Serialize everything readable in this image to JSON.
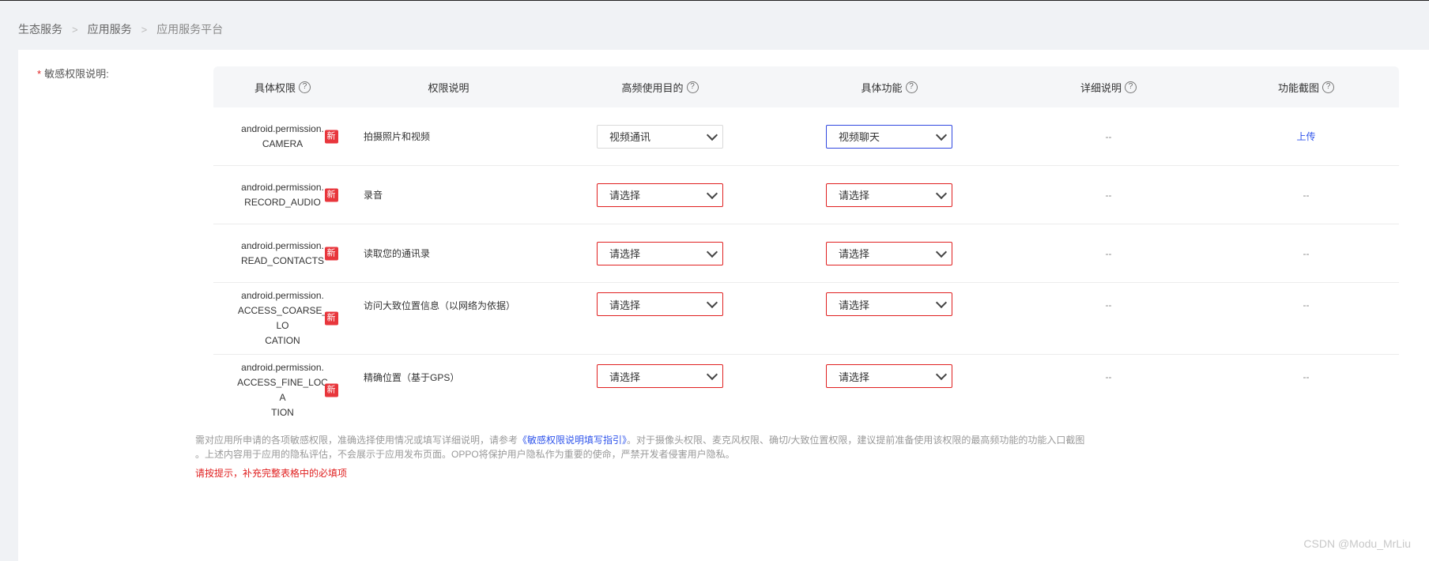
{
  "breadcrumb": {
    "items": [
      "生态服务",
      "应用服务",
      "应用服务平台"
    ],
    "separator": ">"
  },
  "form": {
    "required_mark": "*",
    "label": "敏感权限说明:"
  },
  "table": {
    "headers": {
      "permission": "具体权限",
      "description": "权限说明",
      "purpose": "高频使用目的",
      "function": "具体功能",
      "detail": "详细说明",
      "screenshot": "功能截图"
    },
    "help_glyph": "?",
    "new_badge": "新",
    "rows": [
      {
        "perm_line1": "android.permission.",
        "perm_line2": "CAMERA",
        "desc": "拍摄照片和视频",
        "purpose": "视频通讯",
        "function": "视频聊天",
        "detail": "--",
        "screenshot": "上传"
      },
      {
        "perm_line1": "android.permission.",
        "perm_line2": "RECORD_AUDIO",
        "desc": "录音",
        "purpose": "请选择",
        "function": "请选择",
        "detail": "--",
        "screenshot": "--"
      },
      {
        "perm_line1": "android.permission.",
        "perm_line2": "READ_CONTACTS",
        "desc": "读取您的通讯录",
        "purpose": "请选择",
        "function": "请选择",
        "detail": "--",
        "screenshot": "--"
      },
      {
        "perm_line1": "android.permission.",
        "perm_line2": "ACCESS_COARSE_LO",
        "perm_line3": "CATION",
        "desc": "访问大致位置信息（以网络为依据）",
        "purpose": "请选择",
        "function": "请选择",
        "detail": "--",
        "screenshot": "--"
      },
      {
        "perm_line1": "android.permission.",
        "perm_line2": "ACCESS_FINE_LOCA",
        "perm_line3": "TION",
        "desc": "精确位置（基于GPS）",
        "purpose": "请选择",
        "function": "请选择",
        "detail": "--",
        "screenshot": "--"
      }
    ]
  },
  "note": {
    "text_before": "需对应用所申请的各项敏感权限，准确选择使用情况或填写详细说明，请参考",
    "link": "《敏感权限说明填写指引》",
    "text_after": "。对于摄像头权限、麦克风权限、确切/大致位置权限，建议提前准备使用该权限的最高频功能的功能入口截图 。上述内容用于应用的隐私评估，不会展示于应用发布页面。OPPO将保护用户隐私作为重要的使命，严禁开发者侵害用户隐私。"
  },
  "error_tip": "请按提示，补充完整表格中的必填项",
  "watermark": "CSDN @Modu_MrLiu",
  "colors": {
    "error": "#e02020",
    "link": "#2f54eb",
    "badge": "#e8363c",
    "focus": "#3048e0"
  }
}
